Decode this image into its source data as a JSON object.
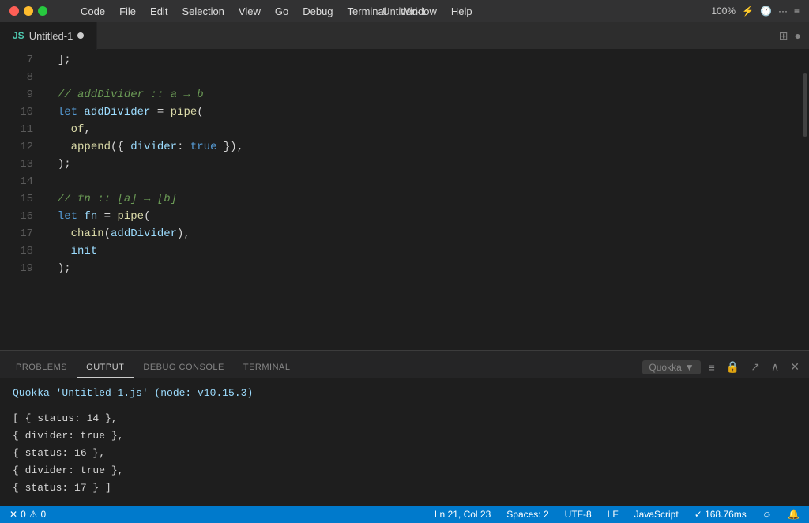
{
  "titlebar": {
    "title": "Untitled-1",
    "menu": [
      "",
      "Code",
      "File",
      "Edit",
      "Selection",
      "View",
      "Go",
      "Debug",
      "Terminal",
      "Window",
      "Help"
    ],
    "battery": "100%",
    "apple_icon": ""
  },
  "tab": {
    "icon": "JS",
    "filename": "Untitled-1",
    "split_icon": "⊞",
    "dot_icon": "●"
  },
  "code_lines": [
    {
      "num": "7",
      "content": "  ];"
    },
    {
      "num": "8",
      "content": ""
    },
    {
      "num": "9",
      "content": "  // addDivider :: a → b"
    },
    {
      "num": "10",
      "content": "  let addDivider = pipe(",
      "breakpoint": true
    },
    {
      "num": "11",
      "content": "    of,"
    },
    {
      "num": "12",
      "content": "    append({ divider: true }),"
    },
    {
      "num": "13",
      "content": "  );"
    },
    {
      "num": "14",
      "content": ""
    },
    {
      "num": "15",
      "content": "  // fn :: [a] → [b]"
    },
    {
      "num": "16",
      "content": "  let fn = pipe(",
      "breakpoint": true
    },
    {
      "num": "17",
      "content": "    chain(addDivider),"
    },
    {
      "num": "18",
      "content": "    init"
    },
    {
      "num": "19",
      "content": "  );"
    }
  ],
  "panel": {
    "tabs": [
      "PROBLEMS",
      "OUTPUT",
      "DEBUG CONSOLE",
      "TERMINAL"
    ],
    "active_tab": "OUTPUT",
    "dropdown_label": "Quokka",
    "output_header": "Quokka 'Untitled-1.js' (node: v10.15.3)",
    "output_lines": [
      "[ { status: 14 },",
      "  { divider: true },",
      "  { status: 16 },",
      "  { divider: true },",
      "  { status: 17 } ]"
    ]
  },
  "statusbar": {
    "errors": "0",
    "warnings": "0",
    "ln_col": "Ln 21, Col 23",
    "spaces": "Spaces: 2",
    "encoding": "UTF-8",
    "eol": "LF",
    "language": "JavaScript",
    "timing": "✓ 168.76ms",
    "smiley": "☺",
    "bell": "🔔"
  }
}
